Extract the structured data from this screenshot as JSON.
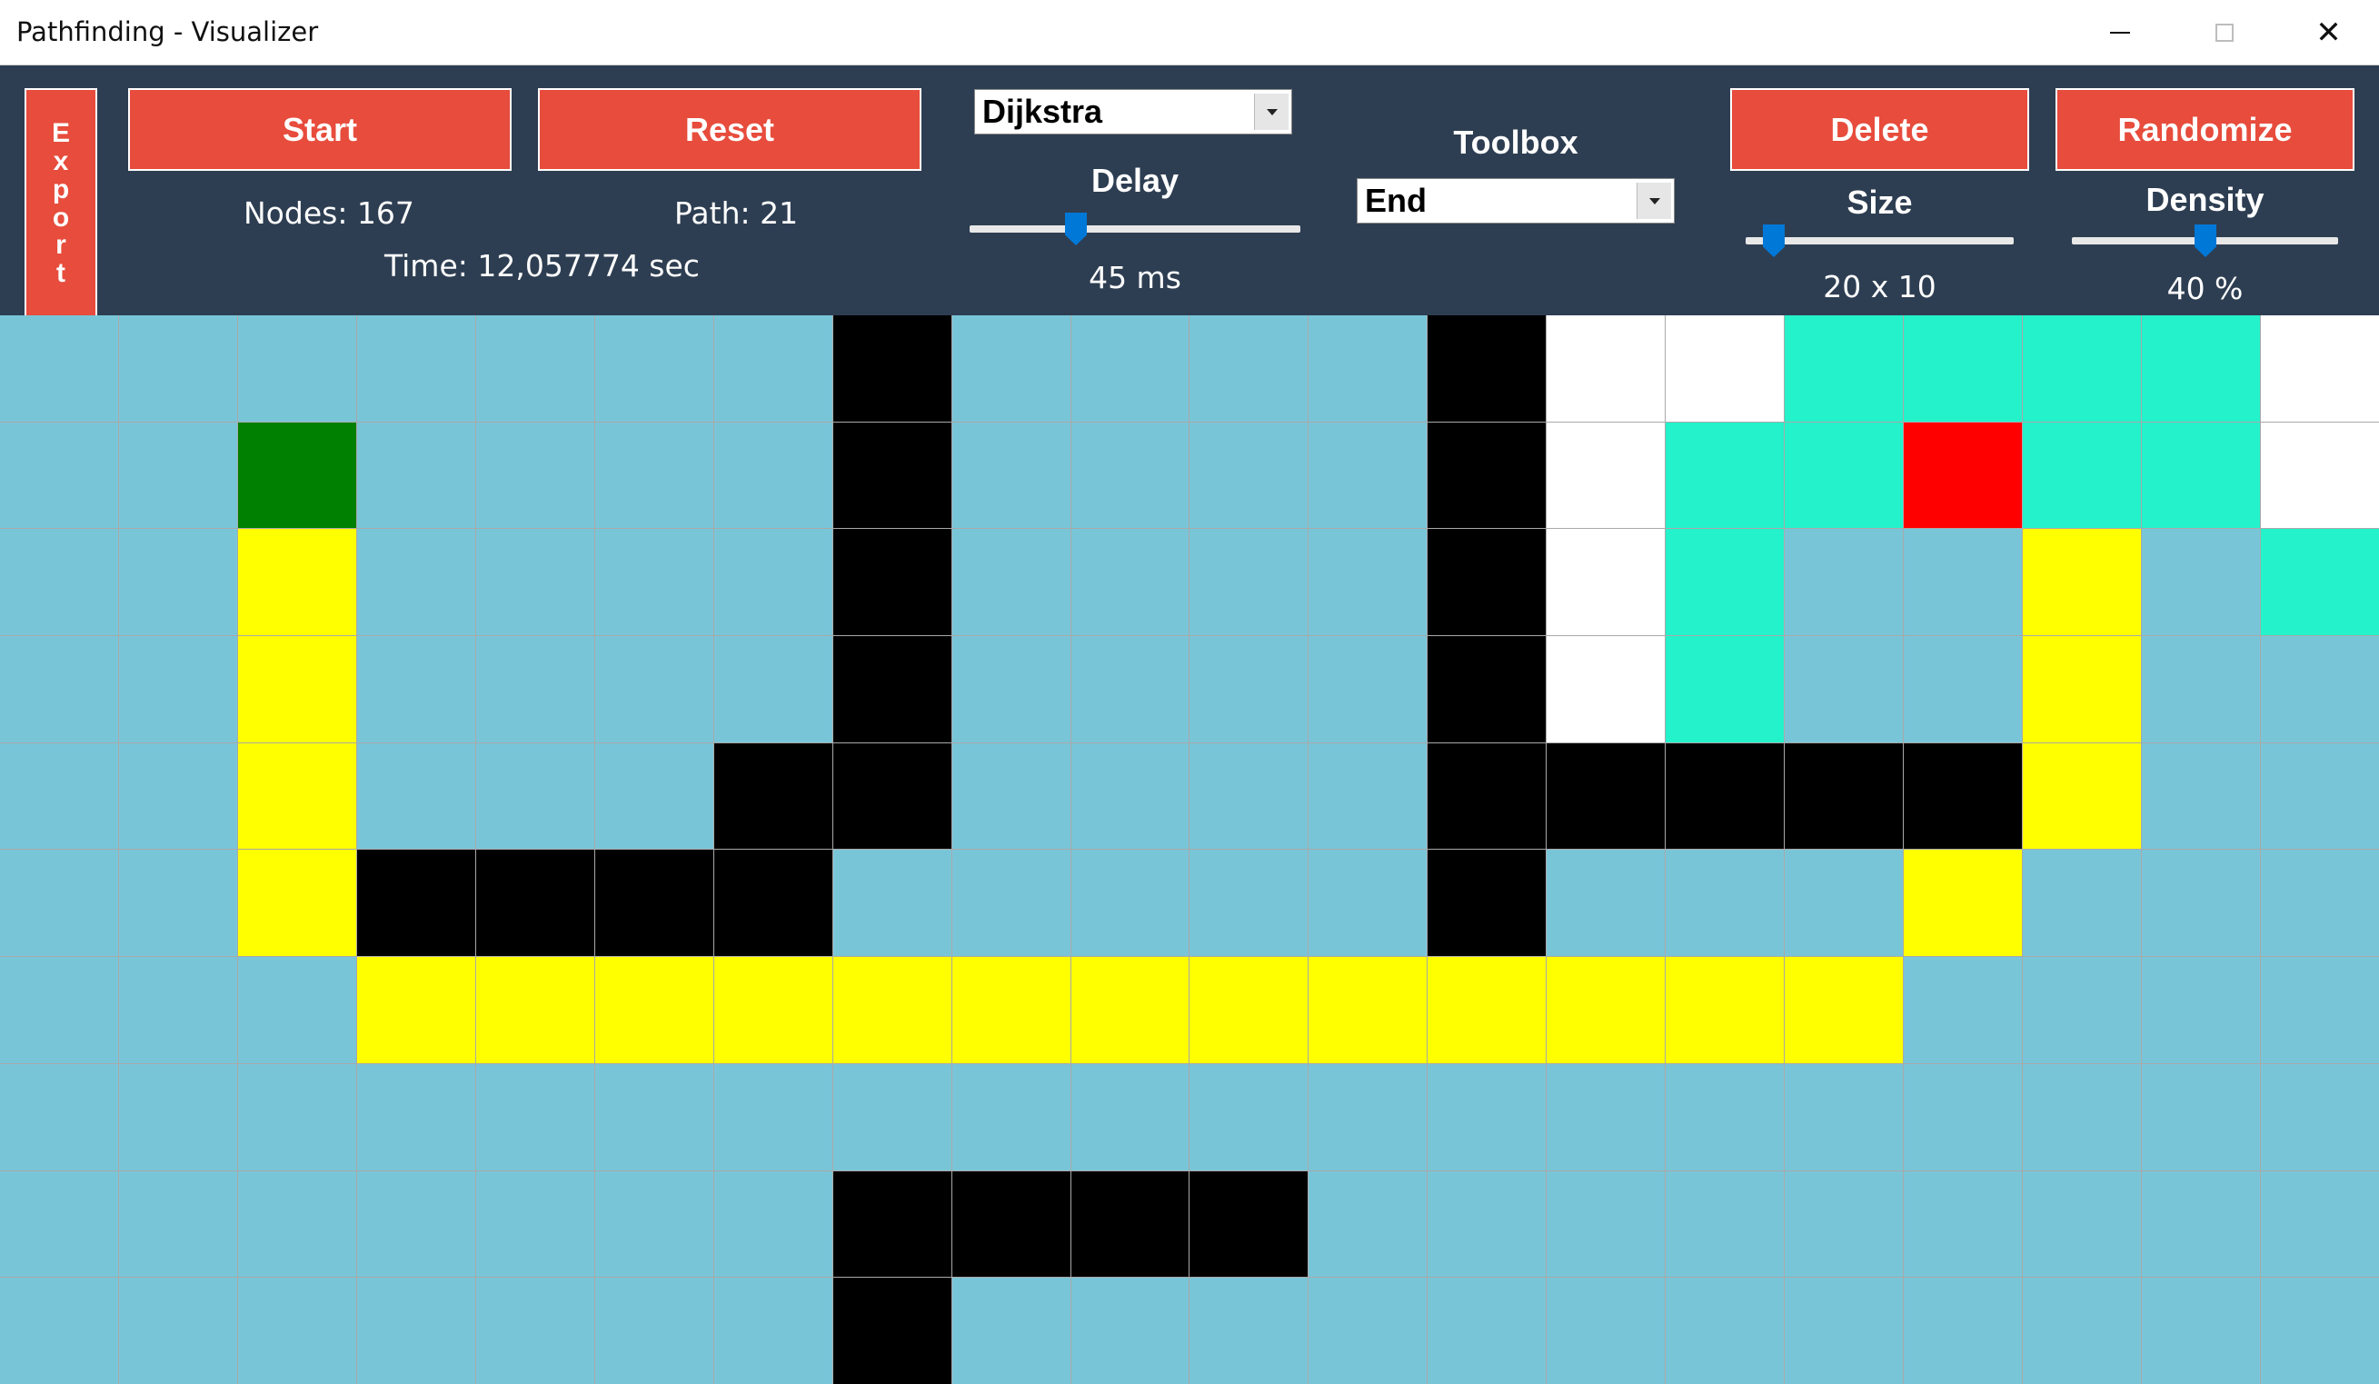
{
  "window": {
    "title": "Pathfinding - Visualizer",
    "controls": [
      {
        "name": "minimize",
        "icon": "minimize-icon"
      },
      {
        "name": "maximize",
        "icon": "maximize-icon"
      },
      {
        "name": "close",
        "icon": "close-icon",
        "glyph": "✕"
      }
    ]
  },
  "toolbar": {
    "export_label": [
      "E",
      "x",
      "p",
      "o",
      "r",
      "t"
    ],
    "start_label": "Start",
    "reset_label": "Reset",
    "delete_label": "Delete",
    "randomize_label": "Randomize",
    "stats": {
      "nodes": "Nodes: 167",
      "path": "Path: 21",
      "time": "Time: 12,057774 sec"
    },
    "algorithm": {
      "selected": "Dijkstra"
    },
    "delay": {
      "label": "Delay",
      "value_text": "45 ms",
      "level": 0.31
    },
    "toolbox": {
      "label": "Toolbox",
      "selected": "End"
    },
    "size": {
      "label": "Size",
      "value_text": "20 x 10",
      "level": 0.07
    },
    "density": {
      "label": "Density",
      "value_text": "40 %",
      "level": 0.5
    },
    "colors": {
      "background": "#2e3e52",
      "button": "#e74c3c",
      "slider_thumb": "#0078d7"
    }
  },
  "grid": {
    "cols": 20,
    "rows": 10,
    "legend": {
      "W": "wall",
      "S": "start",
      "E": "end",
      "P": "path",
      "V": "visited",
      "F": "frontier",
      ".": "empty"
    },
    "colors": {
      "empty": "#79c5d8",
      "wall": "#000000",
      "start": "#008000",
      "end": "#ff0000",
      "path": "#ffff00",
      "visited": "#ffffff",
      "frontier": "#23f2cb",
      "lines": "#a9a9a9"
    },
    "cells": [
      ".......W....WVVFFFFV",
      "..S....W....WVFFEFFV",
      "..P....W....WVF..P.F",
      "..P....W....WVF..P..",
      "..P...WW....WWWWWP..",
      "..PWWWW.....W...P...",
      "...PPPPPPPPPPPPP....",
      "....................",
      ".......WWWW.........",
      ".......W............"
    ]
  }
}
